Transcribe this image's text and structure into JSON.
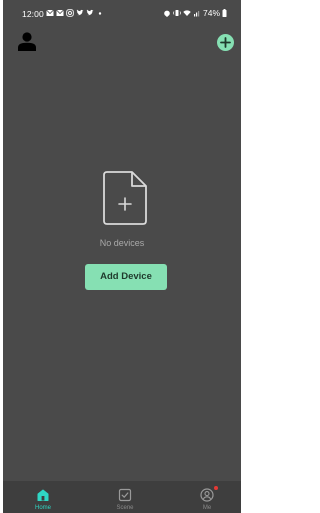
{
  "status_bar": {
    "time": "12:00",
    "battery": "74%",
    "left_icons": [
      "mail-icon",
      "mail-icon",
      "instagram-icon",
      "twitter-icon",
      "twitter-icon",
      "dot-icon"
    ],
    "right_icons": [
      "alarm-icon",
      "vibrate-icon",
      "wifi-icon",
      "signal-icon",
      "battery-icon"
    ]
  },
  "header": {
    "profile_icon": "person-icon",
    "add_icon": "plus-circle-icon"
  },
  "empty_state": {
    "icon": "add-document-icon",
    "message": "No devices",
    "button_label": "Add Device"
  },
  "bottom_nav": {
    "items": [
      {
        "label": "Home",
        "icon": "home-icon",
        "active": true
      },
      {
        "label": "Scene",
        "icon": "checkbox-icon",
        "active": false
      },
      {
        "label": "Me",
        "icon": "profile-icon",
        "active": false,
        "badge": true
      }
    ]
  },
  "colors": {
    "background": "#4a4a4a",
    "accent_green": "#86e0b3",
    "nav_active": "#2fd6c4",
    "nav_background": "#3e3e3e",
    "badge_red": "#e53935"
  }
}
